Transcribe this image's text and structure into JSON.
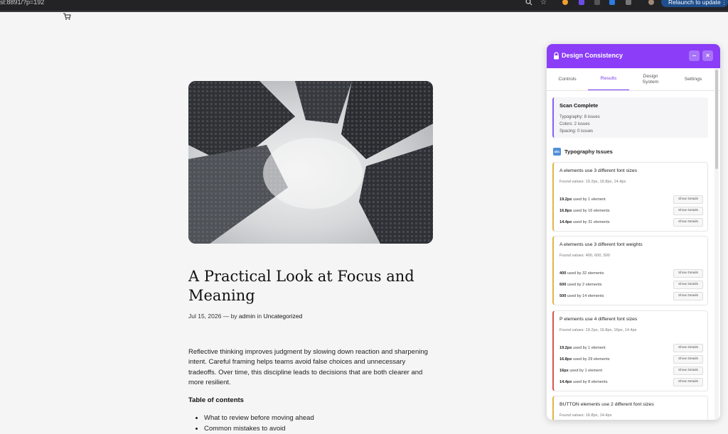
{
  "browser": {
    "url": "st:8891/?p=192",
    "relaunch_label": "Relaunch to update",
    "menu_glyph": "⋮"
  },
  "article": {
    "title": "A Practical Look at Focus and Meaning",
    "date": "Jul 15, 2026",
    "by_sep": "— by",
    "author": "admin",
    "in_sep": "in",
    "category": "Uncategorized",
    "body": "Reflective thinking improves judgment by slowing down reaction and sharpening intent. Careful framing helps teams avoid false choices and unnecessary tradeoffs. Over time, this discipline leads to decisions that are both clearer and more resilient.",
    "toc_heading": "Table of contents",
    "toc_items": [
      "What to review before moving ahead",
      "Common mistakes to avoid"
    ]
  },
  "panel": {
    "title": "Design Consistency",
    "minimize": "–",
    "close": "×",
    "tabs": [
      "Controls",
      "Results",
      "Design System",
      "Settings"
    ],
    "summary": {
      "title": "Scan Complete",
      "lines": [
        "Typography: 8 issues",
        "Colors: 2 issues",
        "Spacing: 0 issues"
      ]
    },
    "section_icon": "abc",
    "section_title": "Typography Issues",
    "show_details": "Show Details",
    "cards": [
      {
        "title": "A elements use 3 different font sizes",
        "found": "Found values: 19.2px, 16.8px, 14.4px",
        "rows": [
          {
            "value": "19.2px",
            "usage": "used by 1 element"
          },
          {
            "value": "16.8px",
            "usage": "used by 16 elements"
          },
          {
            "value": "14.4px",
            "usage": "used by 31 elements"
          }
        ]
      },
      {
        "title": "A elements use 3 different font weights",
        "found": "Found values: 400, 600, 500",
        "rows": [
          {
            "value": "400",
            "usage": "used by 32 elements"
          },
          {
            "value": "600",
            "usage": "used by 2 elements"
          },
          {
            "value": "500",
            "usage": "used by 14 elements"
          }
        ]
      },
      {
        "title": "P elements use 4 different font sizes",
        "found": "Found values: 19.2px, 16.8px, 16px, 14.4px",
        "rows": [
          {
            "value": "19.2px",
            "usage": "used by 1 element"
          },
          {
            "value": "16.8px",
            "usage": "used by 29 elements"
          },
          {
            "value": "16px",
            "usage": "used by 1 element"
          },
          {
            "value": "14.4px",
            "usage": "used by 8 elements"
          }
        ]
      },
      {
        "title": "BUTTON elements use 2 different font sizes",
        "found": "Found values: 16.8px, 14.4px",
        "rows": []
      }
    ]
  }
}
